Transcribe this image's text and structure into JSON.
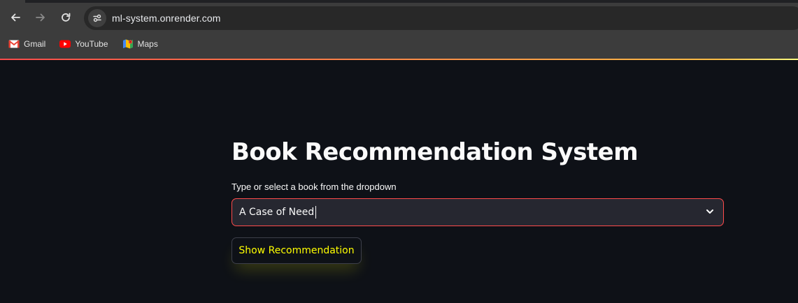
{
  "browser": {
    "url": "ml-system.onrender.com",
    "nav_icons": [
      "back-arrow-icon",
      "forward-arrow-icon",
      "reload-icon"
    ],
    "site_info_icon": "tune-icon",
    "bookmarks": [
      {
        "label": "Gmail",
        "icon": "gmail-icon"
      },
      {
        "label": "YouTube",
        "icon": "youtube-icon"
      },
      {
        "label": "Maps",
        "icon": "maps-icon"
      }
    ]
  },
  "app": {
    "title": "Book Recommendation System",
    "select_label": "Type or select a book from the dropdown",
    "select_value": "A Case of Need",
    "button_label": "Show Recommendation"
  },
  "colors": {
    "background": "#0e1117",
    "input_background": "#262730",
    "input_border_focus": "#ff4b4b",
    "button_text": "#ffff00",
    "text": "#fafafa"
  }
}
